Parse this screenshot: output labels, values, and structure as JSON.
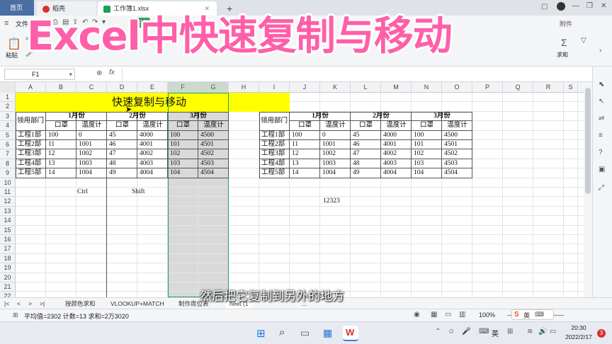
{
  "browser": {
    "tabs": [
      "首页",
      "稻壳",
      "工作簿1.xlsx"
    ],
    "new_tab": "+"
  },
  "ribbon": {
    "file_menu": "文件",
    "start_label": "开始",
    "paste_label": "粘贴",
    "insert_label": "插",
    "attach_label": "附件",
    "sum_label": "求和"
  },
  "banner": {
    "text": "Excel中快速复制与移动"
  },
  "formula_bar": {
    "cell_ref": "F1",
    "fx": "fx"
  },
  "columns": [
    "A",
    "B",
    "C",
    "D",
    "E",
    "F",
    "G",
    "H",
    "I",
    "J",
    "K",
    "L",
    "M",
    "N",
    "O",
    "P",
    "Q",
    "R",
    "S"
  ],
  "rows": [
    "1",
    "2",
    "3",
    "4",
    "5",
    "6",
    "7",
    "8",
    "9",
    "10",
    "11",
    "12",
    "13",
    "14",
    "15",
    "16",
    "17",
    "18",
    "19",
    "20",
    "21",
    "22"
  ],
  "sheet": {
    "title": "快速复制与移动",
    "dept_header": "领用部门",
    "month_headers": [
      "1月份",
      "2月份",
      "3月份"
    ],
    "sub_headers": [
      "口罩",
      "温度计",
      "口罩",
      "温度计",
      "口罩",
      "温度计"
    ],
    "table_rows": [
      [
        "工程1部",
        "100",
        "0",
        "45",
        "4000",
        "100",
        "4500"
      ],
      [
        "工程2部",
        "11",
        "1001",
        "46",
        "4001",
        "101",
        "4501"
      ],
      [
        "工程3部",
        "12",
        "1002",
        "47",
        "4002",
        "102",
        "4502"
      ],
      [
        "工程4部",
        "13",
        "1003",
        "48",
        "4003",
        "103",
        "4503"
      ],
      [
        "工程5部",
        "14",
        "1004",
        "49",
        "4004",
        "104",
        "4504"
      ]
    ],
    "note_ctrl": "Ctrl",
    "note_shift": "Shift",
    "note_value": "12323"
  },
  "sheet_tabs": [
    "按颜色求和",
    "VLOOKUP+MATCH",
    "制作席位表",
    "heet (1",
    "..."
  ],
  "subtitle": "然后把它复制到另外的地方",
  "status": {
    "text": "平均值=2302  计数=13  求和=2万3020",
    "zoom": "100%"
  },
  "taskbar": {
    "ime": "英",
    "time": "20:30",
    "date": "2022/2/17",
    "badge": "3"
  },
  "colors": {
    "title_fill": "#ffff00",
    "selection_fill": "#d9d9d9",
    "selection_border": "#21a366",
    "banner_text": "#ff5fa8"
  }
}
